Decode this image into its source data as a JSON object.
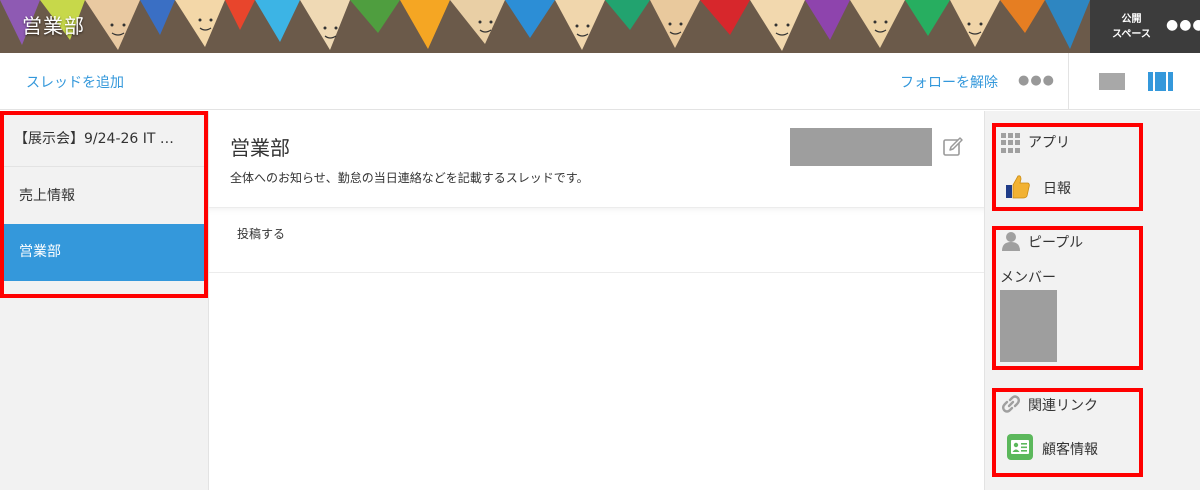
{
  "header": {
    "space_title": "営業部",
    "public_label_line1": "公開",
    "public_label_line2": "スペース",
    "more_label": "●●●"
  },
  "toolbar": {
    "add_thread_label": "スレッドを追加",
    "unfollow_label": "フォローを解除",
    "more_label": "●●●"
  },
  "sidebar": {
    "threads": [
      {
        "label": "【展示会】9/24-26 IT …"
      },
      {
        "label": "売上情報"
      },
      {
        "label": "営業部",
        "selected": true
      }
    ]
  },
  "main": {
    "thread_title": "営業部",
    "thread_description": "全体へのお知らせ、勤怠の当日連絡などを記載するスレッドです。",
    "post_label": "投稿する"
  },
  "rightpanel": {
    "apps": {
      "heading": "アプリ",
      "items": [
        {
          "label": "日報",
          "icon": "thumbs-up-icon"
        }
      ]
    },
    "people": {
      "heading": "ピープル",
      "members_label": "メンバー"
    },
    "related_links": {
      "heading": "関連リンク",
      "items": [
        {
          "label": "顧客情報",
          "icon": "contact-card-icon"
        }
      ]
    }
  },
  "colors": {
    "accent": "#3498db",
    "selected_bg": "#3498db",
    "highlight_border": "#ff0000"
  }
}
